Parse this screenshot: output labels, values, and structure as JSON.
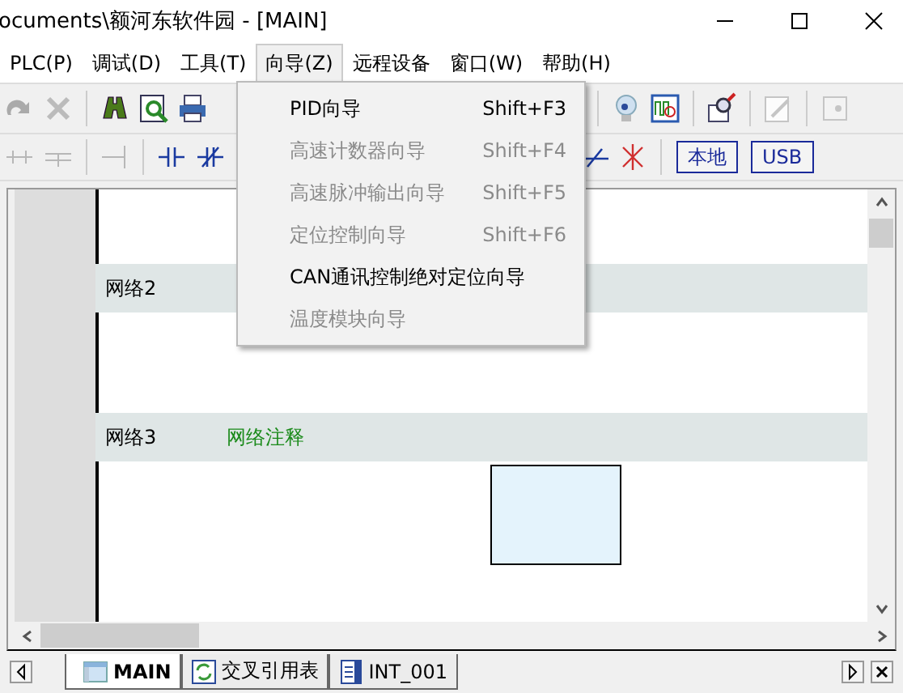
{
  "window": {
    "title": "ocuments\\额河东软件园 - [MAIN]"
  },
  "menubar": [
    {
      "label": "PLC(P)",
      "open": false
    },
    {
      "label": "调试(D)",
      "open": false
    },
    {
      "label": "工具(T)",
      "open": false
    },
    {
      "label": "向导(Z)",
      "open": true
    },
    {
      "label": "远程设备",
      "open": false
    },
    {
      "label": "窗口(W)",
      "open": false
    },
    {
      "label": "帮助(H)",
      "open": false
    }
  ],
  "dropdown": [
    {
      "label": "PID向导",
      "shortcut": "Shift+F3",
      "disabled": false
    },
    {
      "label": "高速计数器向导",
      "shortcut": "Shift+F4",
      "disabled": true
    },
    {
      "label": "高速脉冲输出向导",
      "shortcut": "Shift+F5",
      "disabled": true
    },
    {
      "label": "定位控制向导",
      "shortcut": "Shift+F6",
      "disabled": true
    },
    {
      "label": "CAN通讯控制绝对定位向导",
      "disabled": false
    },
    {
      "label": "温度模块向导",
      "disabled": true
    }
  ],
  "connection_buttons": [
    "本地",
    "USB"
  ],
  "networks": [
    {
      "label": "网络2"
    },
    {
      "label": "网络3",
      "comment": "网络注释"
    }
  ],
  "tabs": [
    {
      "label": "MAIN",
      "kind": "program",
      "selected": true
    },
    {
      "label": "交叉引用表",
      "kind": "crossref",
      "selected": false
    },
    {
      "label": "INT_001",
      "kind": "interrupt",
      "selected": false
    }
  ]
}
